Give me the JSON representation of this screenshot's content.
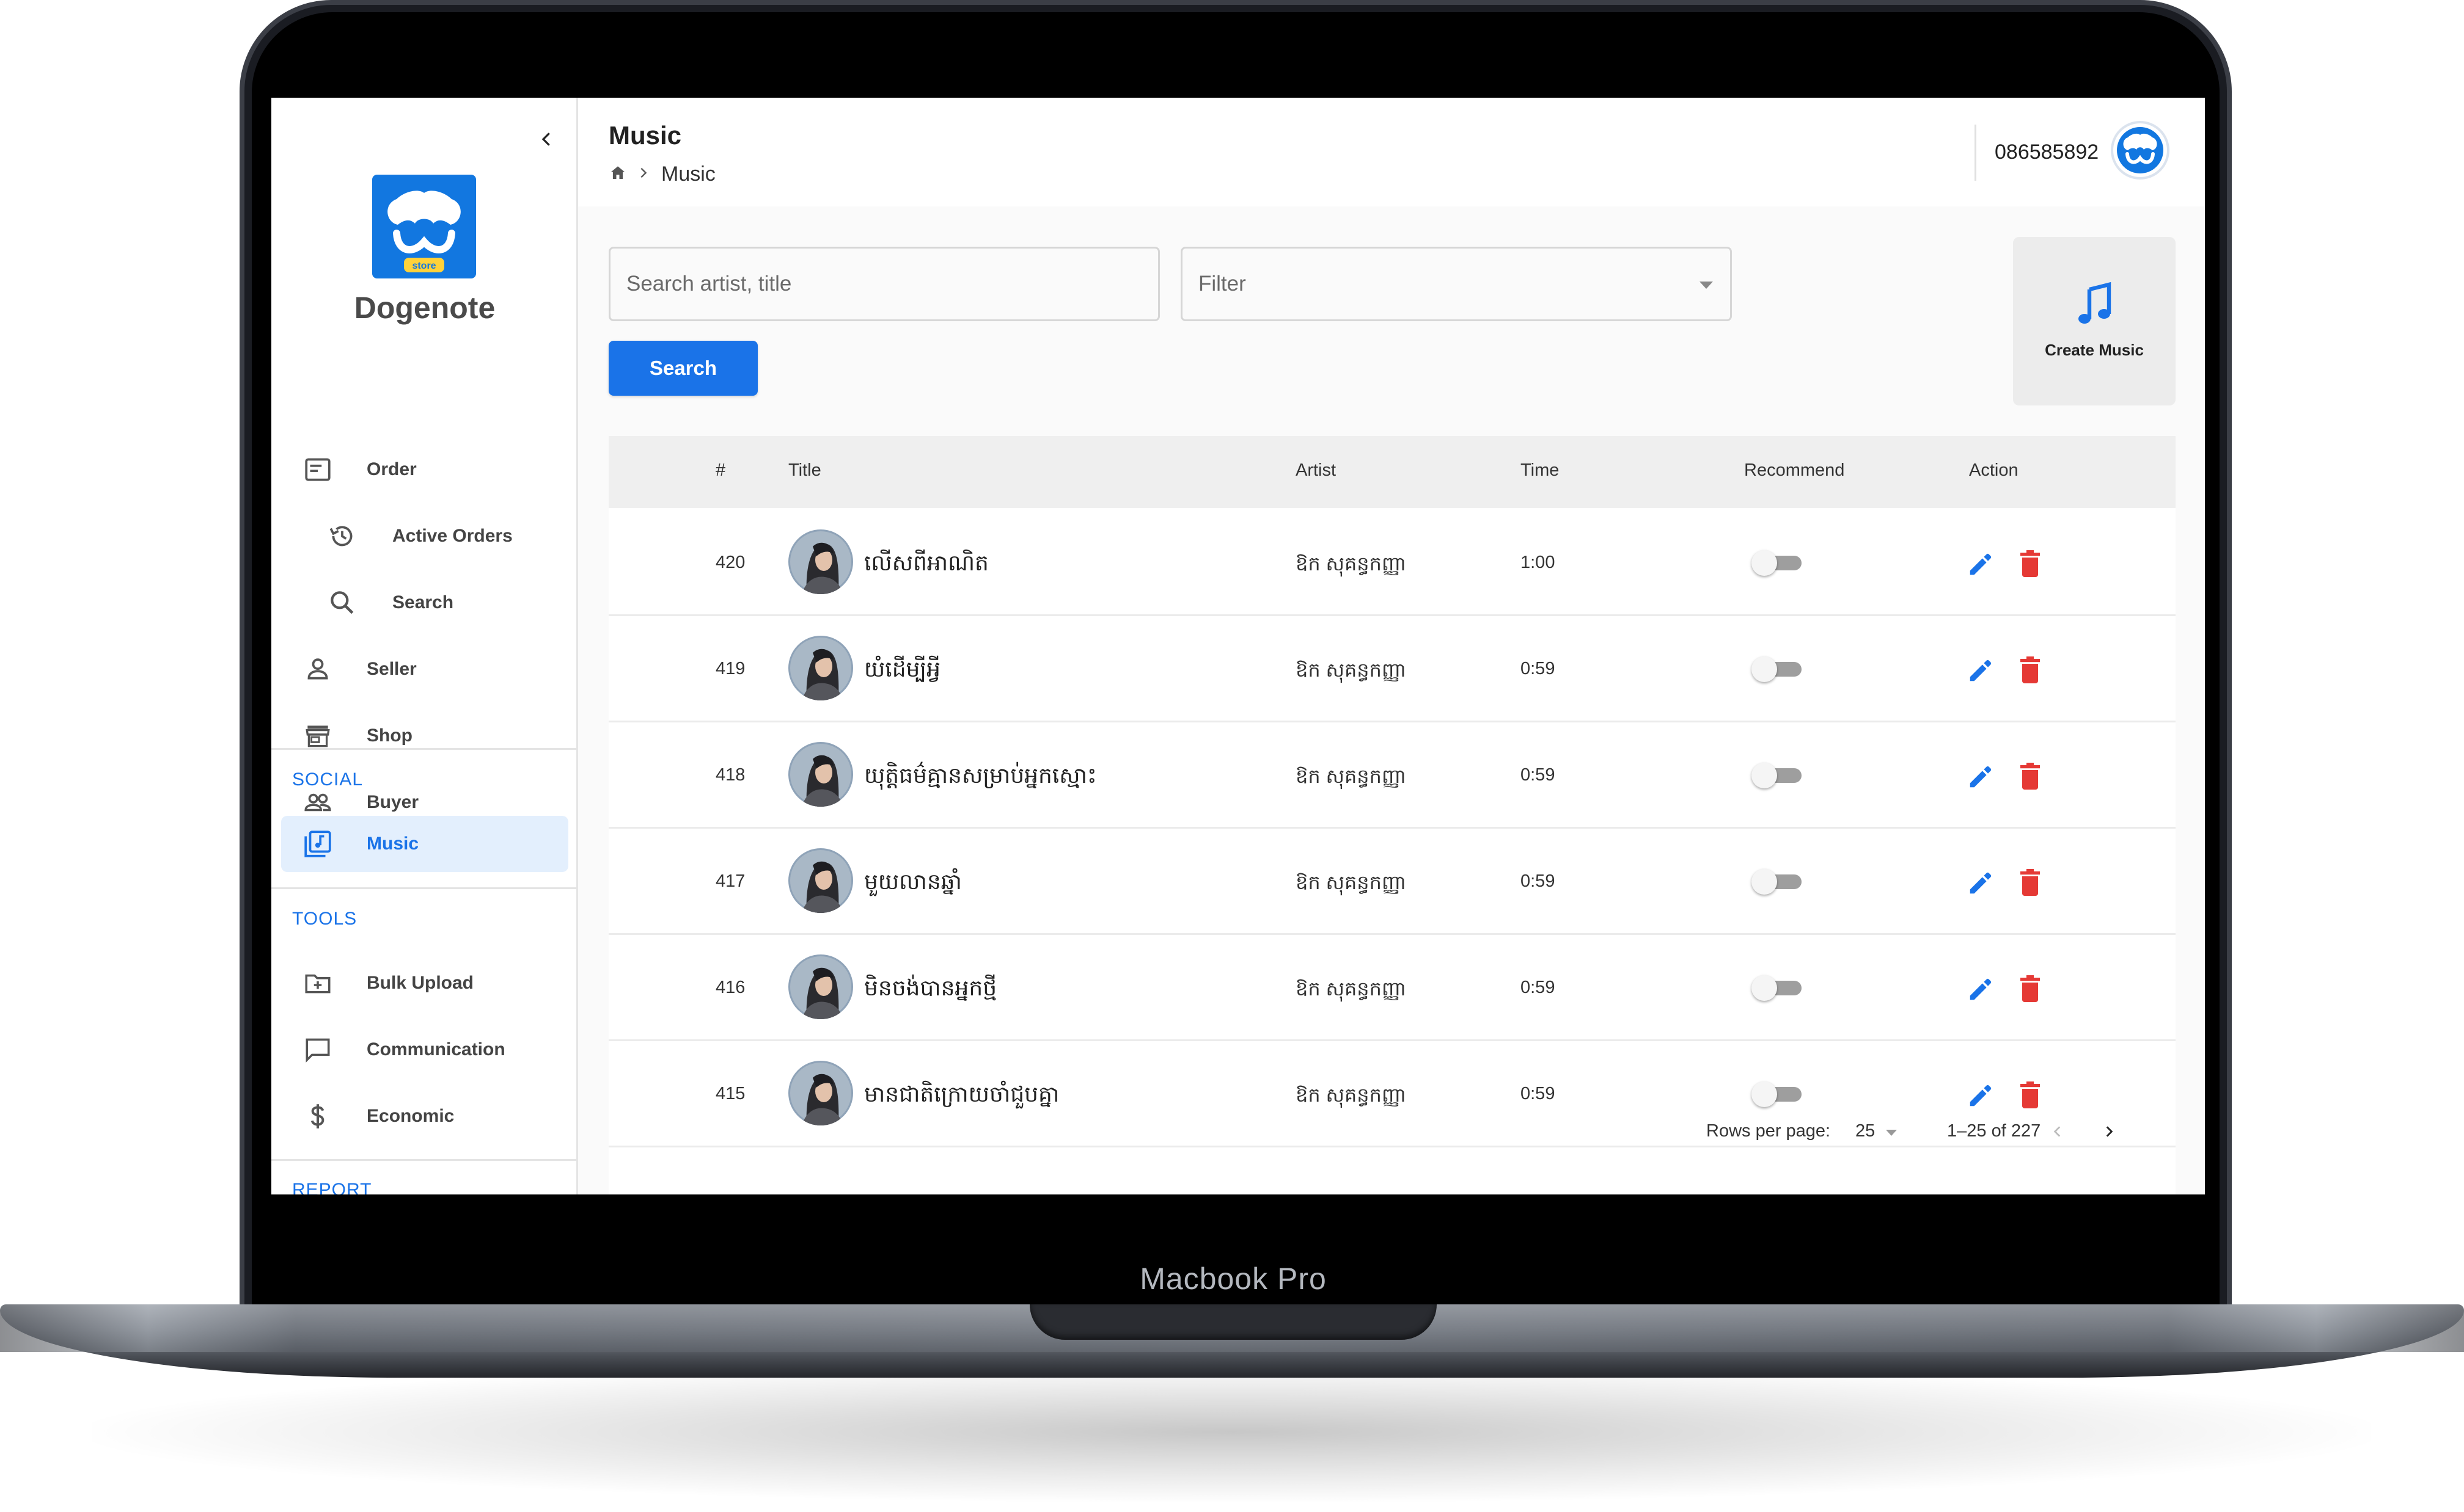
{
  "device": {
    "model_label": "Macbook Pro"
  },
  "sidebar": {
    "brand": "Dogenote",
    "logo_badge": "store",
    "items": [
      {
        "label": "Order",
        "icon": "order-icon"
      },
      {
        "label": "Active Orders",
        "icon": "history-icon"
      },
      {
        "label": "Search",
        "icon": "search-icon"
      },
      {
        "label": "Seller",
        "icon": "person-icon"
      },
      {
        "label": "Shop",
        "icon": "store-icon"
      },
      {
        "label": "Buyer",
        "icon": "people-icon"
      }
    ],
    "social_label": "SOCIAL",
    "social_items": [
      {
        "label": "Music",
        "icon": "library-music-icon",
        "active": true
      }
    ],
    "tools_label": "TOOLS",
    "tools_items": [
      {
        "label": "Bulk Upload",
        "icon": "folder-add-icon"
      },
      {
        "label": "Communication",
        "icon": "chat-icon"
      },
      {
        "label": "Economic",
        "icon": "dollar-icon"
      }
    ],
    "report_label": "REPORT"
  },
  "header": {
    "title": "Music",
    "breadcrumb": [
      {
        "icon": "home-icon"
      },
      {
        "label": "Music"
      }
    ],
    "user_phone": "086585892"
  },
  "toolbar": {
    "search_placeholder": "Search artist, title",
    "filter_placeholder": "Filter",
    "search_button": "Search",
    "create_label": "Create Music"
  },
  "table": {
    "columns": [
      "#",
      "Title",
      "Artist",
      "Time",
      "Recommend",
      "Action"
    ],
    "rows": [
      {
        "num": "420",
        "title": "លើសពីអាណិត",
        "artist": "ឱក សុគន្ធកញ្ញា",
        "time": "1:00",
        "recommend": false
      },
      {
        "num": "419",
        "title": "យំដើម្បីអ្វី",
        "artist": "ឱក សុគន្ធកញ្ញា",
        "time": "0:59",
        "recommend": false
      },
      {
        "num": "418",
        "title": "យុត្តិធម៌គ្មានសម្រាប់អ្នកស្មោះ",
        "artist": "ឱក សុគន្ធកញ្ញា",
        "time": "0:59",
        "recommend": false
      },
      {
        "num": "417",
        "title": "មួយលានឆ្នាំ",
        "artist": "ឱក សុគន្ធកញ្ញា",
        "time": "0:59",
        "recommend": false
      },
      {
        "num": "416",
        "title": "មិនចង់បានអ្នកថ្មី",
        "artist": "ឱក សុគន្ធកញ្ញា",
        "time": "0:59",
        "recommend": false
      },
      {
        "num": "415",
        "title": "មានជាតិក្រោយចាំជួបគ្នា",
        "artist": "ឱក សុគន្ធកញ្ញា",
        "time": "0:59",
        "recommend": false
      }
    ]
  },
  "pagination": {
    "rows_label": "Rows per page:",
    "rows_value": "25",
    "range": "1–25 of 227"
  },
  "colors": {
    "accent": "#1a73e8",
    "delete": "#e53935",
    "brand_blue": "#1277e0"
  }
}
